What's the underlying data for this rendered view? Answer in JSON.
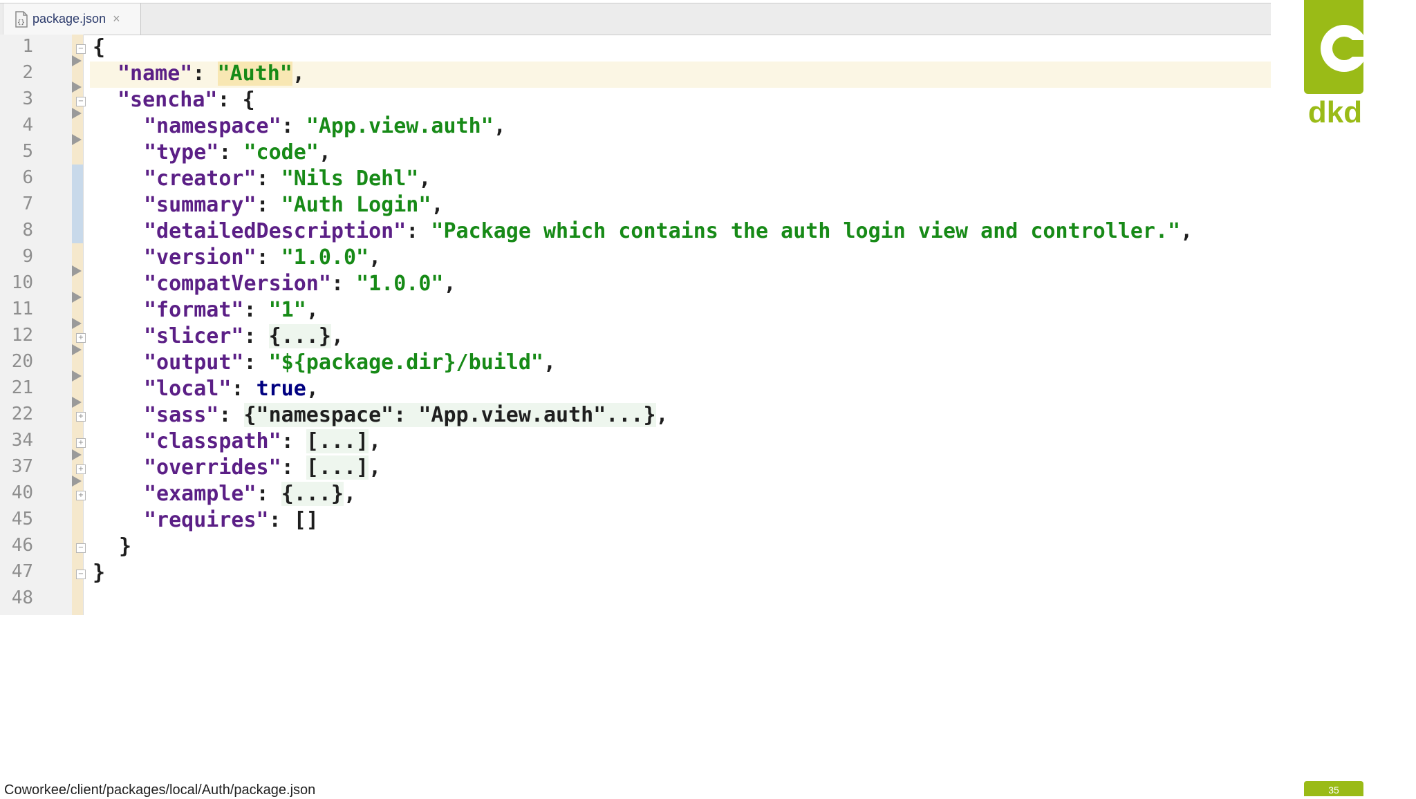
{
  "tab": {
    "label": "package.json",
    "close_icon": "×",
    "file_icon": "json-file-icon"
  },
  "gutter": {
    "line_numbers": [
      "1",
      "2",
      "3",
      "4",
      "5",
      "6",
      "7",
      "8",
      "9",
      "10",
      "11",
      "12",
      "20",
      "21",
      "22",
      "34",
      "37",
      "40",
      "45",
      "46",
      "47",
      "48"
    ]
  },
  "code": {
    "l1": "{",
    "l2_key": "\"name\"",
    "l2_val": "\"Auth\"",
    "l3_key": "\"sencha\"",
    "l3_open": "{",
    "l4_key": "\"namespace\"",
    "l4_val": "\"App.view.auth\"",
    "l5_key": "\"type\"",
    "l5_val": "\"code\"",
    "l6_key": "\"creator\"",
    "l6_val": "\"Nils Dehl\"",
    "l7_key": "\"summary\"",
    "l7_val": "\"Auth Login\"",
    "l8_key": "\"detailedDescription\"",
    "l8_val": "\"Package which contains the auth login view and controller.\"",
    "l9_key": "\"version\"",
    "l9_val": "\"1.0.0\"",
    "l10_key": "\"compatVersion\"",
    "l10_val": "\"1.0.0\"",
    "l11_key": "\"format\"",
    "l11_val": "\"1\"",
    "l12_key": "\"slicer\"",
    "l12_val": "{...}",
    "l20_key": "\"output\"",
    "l20_val": "\"${package.dir}/build\"",
    "l21_key": "\"local\"",
    "l21_val": "true",
    "l22_key": "\"sass\"",
    "l22_val": "{\"namespace\": \"App.view.auth\"...}",
    "l34_key": "\"classpath\"",
    "l34_val": "[...]",
    "l37_key": "\"overrides\"",
    "l37_val": "[...]",
    "l40_key": "\"example\"",
    "l40_val": "{...}",
    "l45_key": "\"requires\"",
    "l45_val": "[]",
    "l46": "}",
    "l47": "}"
  },
  "logo": {
    "text": "dkd"
  },
  "footer": {
    "path": "Coworkee/client/packages/local/Auth/package.json",
    "page": "35"
  },
  "colors": {
    "brand": "#9abb17",
    "key": "#5b1f86",
    "string": "#178a17",
    "keyword": "#000080"
  }
}
